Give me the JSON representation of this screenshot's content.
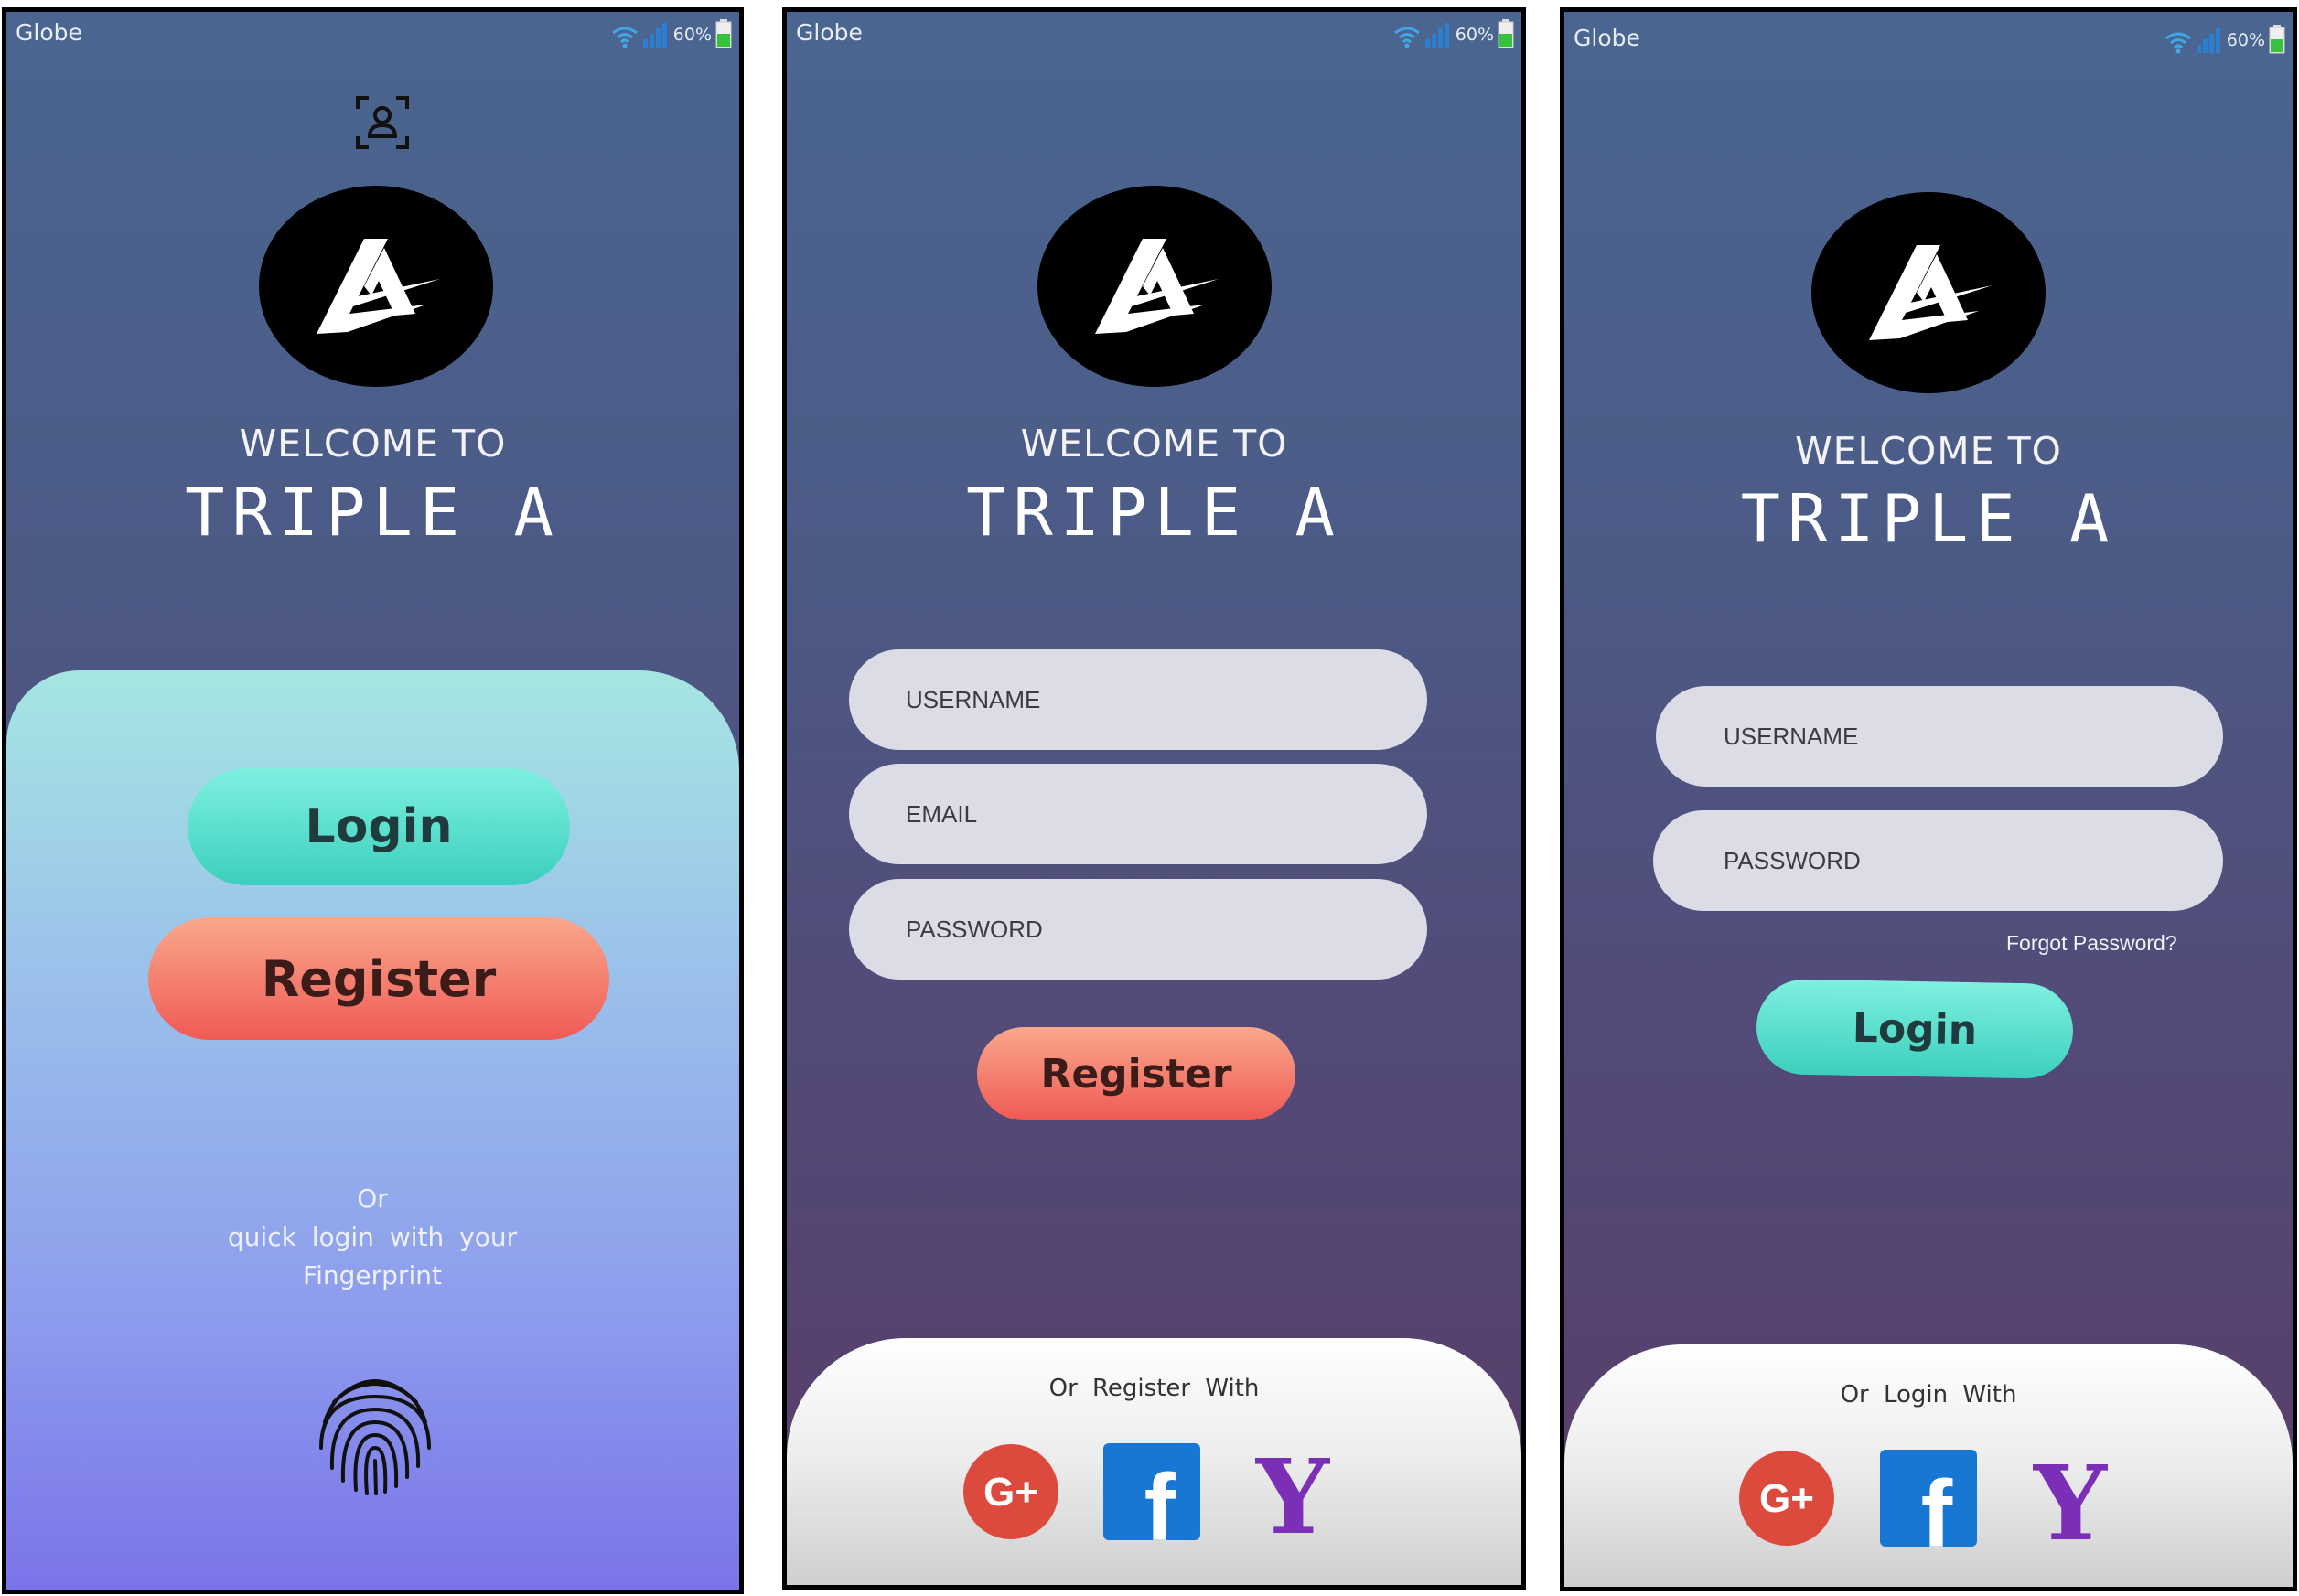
{
  "colors": {
    "background_top": "#4a6690",
    "background_bottom": "#5a3c68",
    "login_button": "#3ccfbd",
    "register_button": "#ef5a55",
    "input_field": "#dcdce6",
    "google": "#dc4a3d",
    "facebook": "#1877d2",
    "yahoo": "#7b2fb6"
  },
  "status_bar": {
    "carrier": "Globe",
    "battery": "60%"
  },
  "welcome": {
    "line1": "WELCOME TO",
    "brand": "TRIPLE A"
  },
  "screen_home": {
    "face_id_icon": "face-id-icon",
    "login_label": "Login",
    "register_label": "Register",
    "quick_login_line1": "Or",
    "quick_login_line2": "quick login with your",
    "quick_login_line3": "Fingerprint",
    "fingerprint_icon": "fingerprint-icon"
  },
  "screen_register": {
    "username_placeholder": "USERNAME",
    "email_placeholder": "EMAIL",
    "password_placeholder": "PASSWORD",
    "register_label": "Register",
    "social_caption": "Or Register With"
  },
  "screen_login": {
    "username_placeholder": "USERNAME",
    "password_placeholder": "PASSWORD",
    "forgot_password": "Forgot Password?",
    "login_label": "Login",
    "social_caption": "Or Login With"
  },
  "social": {
    "google_glyph": "G+",
    "facebook_glyph": "f",
    "yahoo_glyph": "Y"
  }
}
